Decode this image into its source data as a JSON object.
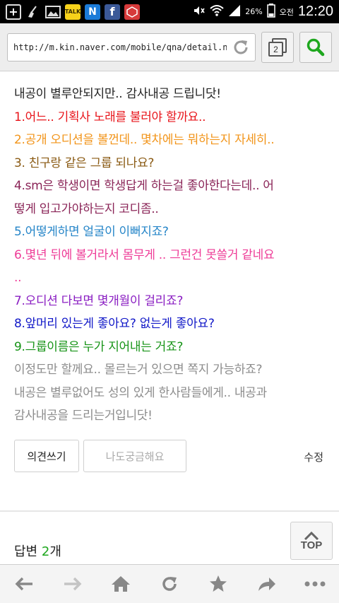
{
  "status_bar": {
    "battery": "26%",
    "ampm": "오전",
    "time": "12:20",
    "app_icons": [
      "plus-icon",
      "broom-icon",
      "image-icon",
      "kakaotalk-icon",
      "naver-icon",
      "facebook-icon",
      "app-red-icon"
    ],
    "talk_label": "TALK",
    "naver_label": "N",
    "facebook_label": "f"
  },
  "browser": {
    "url": "http://m.kin.naver.com/mobile/qna/detail.nh",
    "tab_count": "2"
  },
  "post": {
    "lines": [
      {
        "text": "내공이 별루안되지만.. 감사내공 드립니닷!",
        "color": "#222222"
      },
      {
        "text": "1.어느.. 기획사 노래를 불러야 할까요..",
        "color": "#e8151b"
      },
      {
        "text": "2.공개 오디션을 볼껀데.. 몇차에는 뭐하는지 자세히..",
        "color": "#f2951b"
      },
      {
        "text": "3. 친구랑 같은 그룹 되나요?",
        "color": "#8a5a13"
      },
      {
        "text": "4.sm은 학생이면 학생답게 하는걸 좋아한다는데.. 어",
        "color": "#8a2457"
      },
      {
        "text": "떻게 입고가야하는지 코디좀..",
        "color": "#8a2457"
      },
      {
        "text": "5.어떻게하면 얼굴이 이뻐지죠?",
        "color": "#2585c8"
      },
      {
        "text": "6.몇년 뒤에 볼거라서 몸무게 .. 그런건 못쓸거 같네요",
        "color": "#ee3c97"
      },
      {
        "text": "..",
        "color": "#ee3c97"
      },
      {
        "text": "7.오디션 다보면 몇개월이 걸리죠?",
        "color": "#8a1ec2"
      },
      {
        "text": "8.앞머리 있는게 좋아요? 없는게 좋아요?",
        "color": "#1219c8"
      },
      {
        "text": "9.그룹이름은 누가 지어내는 거죠?",
        "color": "#179417"
      },
      {
        "text": "이정도만 할께요.. 몰르는거 있으면 쪽지 가능하죠?",
        "color": "#8c8c8c"
      },
      {
        "text": "내공은 별루없어도 성의 있게 한사람들에게.. 내공과",
        "color": "#8c8c8c"
      },
      {
        "text": "감사내공을 드리는거입니닷!",
        "color": "#8c8c8c"
      }
    ]
  },
  "actions": {
    "opinion_label": "의견쓰기",
    "curious_label": "나도궁금해요",
    "edit_label": "수정"
  },
  "answers": {
    "label": "답변",
    "count": "2",
    "unit": "개"
  },
  "top_button": {
    "label": "TOP"
  },
  "toolbar": {
    "buttons": [
      "back-icon",
      "forward-icon",
      "home-icon",
      "refresh-icon",
      "bookmark-icon",
      "share-icon",
      "more-icon"
    ]
  }
}
